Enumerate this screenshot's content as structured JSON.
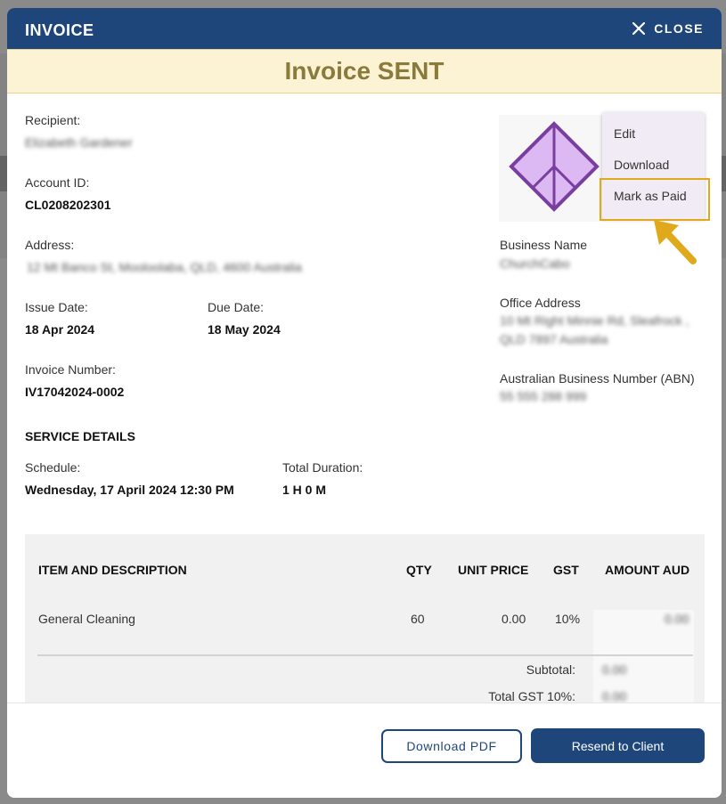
{
  "modal": {
    "title": "INVOICE",
    "close_label": "CLOSE"
  },
  "status_banner": "Invoice SENT",
  "recipient": {
    "label": "Recipient:",
    "value": "Elizabeth Gardener"
  },
  "account": {
    "label": "Account ID:",
    "value": "CL0208202301"
  },
  "address": {
    "label": "Address:",
    "value": "12 Mt Banco St, Mooloolaba, QLD, 4600 Australia"
  },
  "issue_date": {
    "label": "Issue Date:",
    "value": "18 Apr 2024"
  },
  "due_date": {
    "label": "Due Date:",
    "value": "18 May 2024"
  },
  "invoice_number": {
    "label": "Invoice Number:",
    "value": "IV17042024-0002"
  },
  "business": {
    "name_label": "Business Name",
    "name_value": "ChurchCabo",
    "office_label": "Office Address",
    "office_line1": "10 Mt Right Minnie Rd, Sleafrock ,",
    "office_line2": "QLD 7897 Australia",
    "abn_label": "Australian Business Number (ABN)",
    "abn_value": "55 555 288 999"
  },
  "actions_menu": {
    "items": [
      "Edit",
      "Download",
      "Mark as Paid"
    ]
  },
  "service": {
    "title": "SERVICE DETAILS",
    "schedule_label": "Schedule:",
    "schedule_value": "Wednesday, 17 April 2024 12:30 PM",
    "duration_label": "Total Duration:",
    "duration_value": "1 H 0 M"
  },
  "table": {
    "headers": [
      "ITEM AND DESCRIPTION",
      "QTY",
      "UNIT PRICE",
      "GST",
      "AMOUNT AUD"
    ],
    "rows": [
      {
        "item": "General Cleaning",
        "qty": "60",
        "unit_price": "0.00",
        "gst": "10%",
        "amount": "0.00"
      }
    ],
    "subtotal_label": "Subtotal:",
    "subtotal_value": "0.00",
    "total_gst_label": "Total GST 10%:",
    "total_gst_value": "0.00"
  },
  "footer": {
    "download_pdf": "Download PDF",
    "resend": "Resend to Client"
  },
  "colors": {
    "header": "#1e467b",
    "banner_bg": "#fbf3d3",
    "banner_text": "#8a7a3b",
    "highlight": "#e0a91b",
    "logo": "#7a3e9e"
  },
  "icons": {
    "close": "close-icon",
    "logo": "diamond-logo-icon",
    "arrow": "arrow-pointer-icon"
  }
}
